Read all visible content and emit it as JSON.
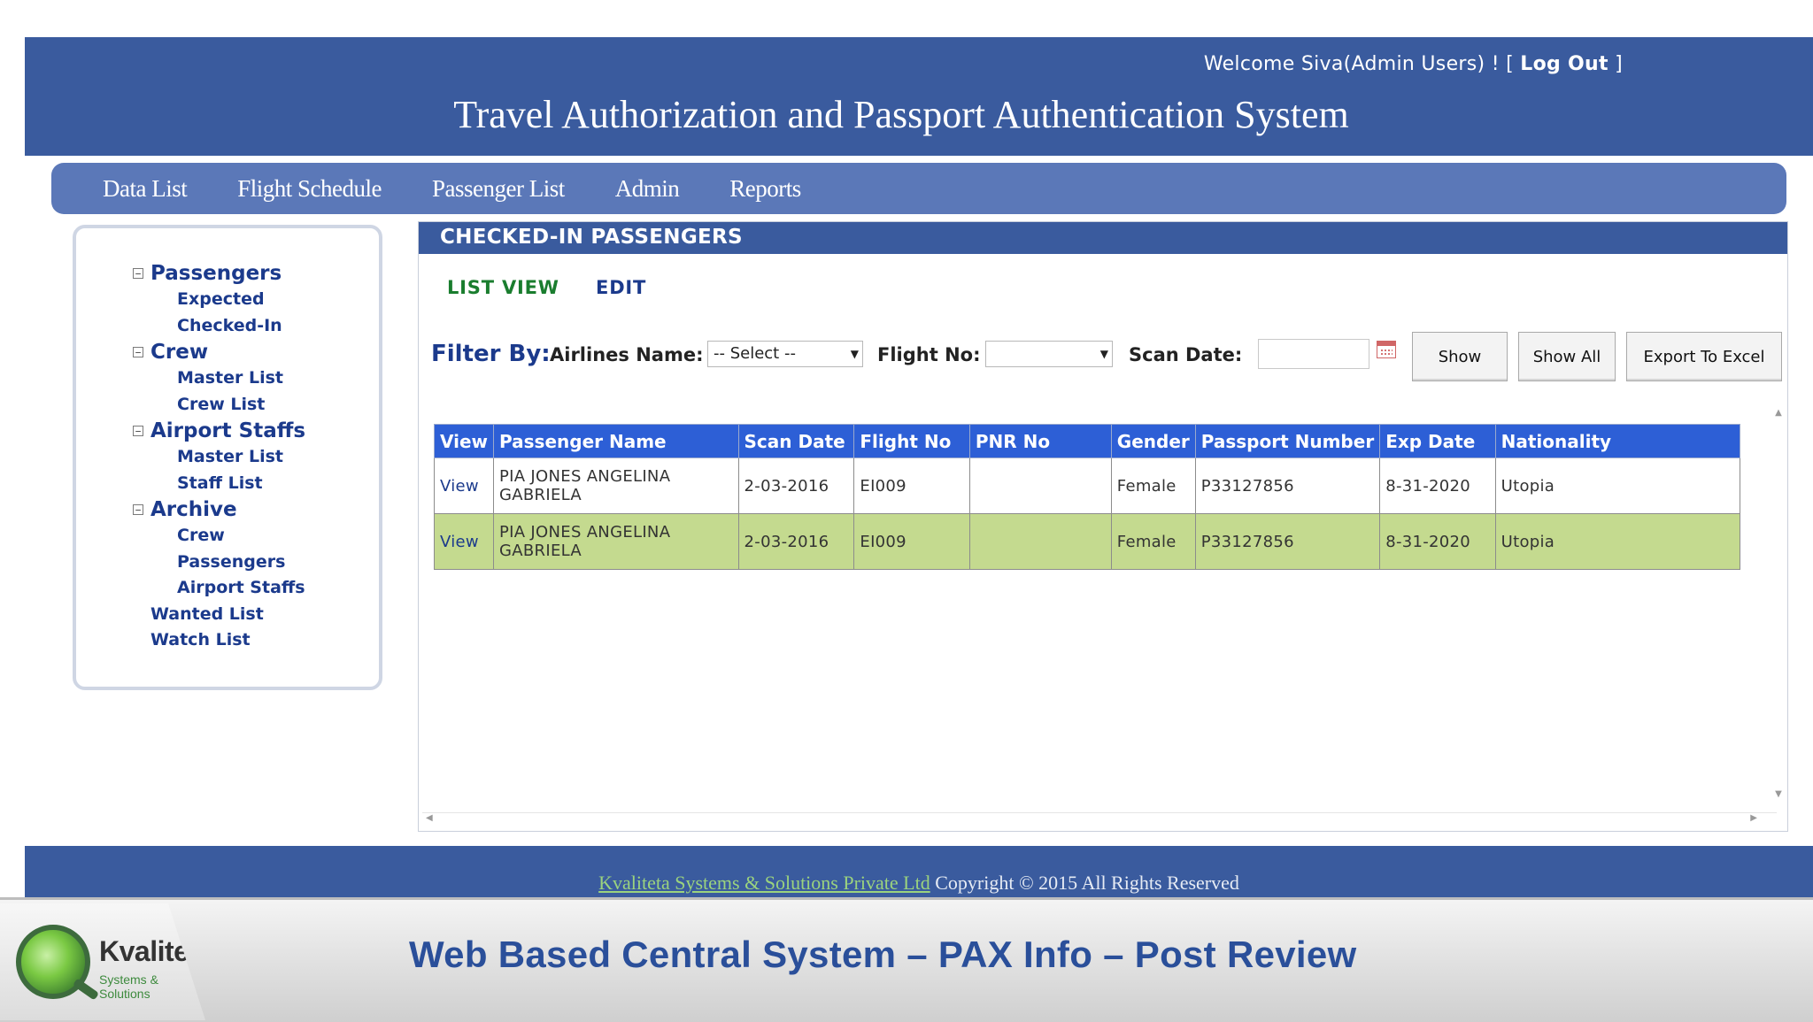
{
  "header": {
    "welcome_prefix": "Welcome Siva(Admin Users) ! [ ",
    "logout_label": "Log Out",
    "welcome_suffix": " ]",
    "app_title": "Travel Authorization and Passport Authentication System"
  },
  "nav": [
    "Data List",
    "Flight Schedule",
    "Passenger List",
    "Admin",
    "Reports"
  ],
  "sidebar": {
    "toggle_icon": "−",
    "groups": [
      {
        "label": "Passengers",
        "children": [
          "Expected",
          "Checked-In"
        ]
      },
      {
        "label": "Crew",
        "children": [
          "Master List",
          "Crew List"
        ]
      },
      {
        "label": "Airport Staffs",
        "children": [
          "Master List",
          "Staff List"
        ]
      },
      {
        "label": "Archive",
        "children": [
          "Crew",
          "Passengers",
          "Airport Staffs"
        ]
      }
    ],
    "leaves": [
      "Wanted List",
      "Watch List"
    ]
  },
  "panel": {
    "title": "CHECKED-IN PASSENGERS",
    "tabs": {
      "list_view": "LIST VIEW",
      "edit": "EDIT"
    },
    "filter": {
      "filter_by": "Filter By:",
      "airlines_label": "Airlines Name:",
      "airlines_value": "-- Select --",
      "flight_label": "Flight No:",
      "flight_value": "",
      "scan_date_label": "Scan Date:",
      "scan_date_value": "",
      "show": "Show",
      "show_all": "Show All",
      "export": "Export To Excel"
    },
    "table": {
      "columns": [
        "View",
        "Passenger Name",
        "Scan Date",
        "Flight No",
        "PNR No",
        "Gender",
        "Passport Number",
        "Exp Date",
        "Nationality"
      ],
      "rows": [
        [
          "View",
          "PIA JONES ANGELINA GABRIELA",
          "2-03-2016",
          "EI009",
          "",
          "Female",
          "P33127856",
          "8-31-2020",
          "Utopia"
        ],
        [
          "View",
          "PIA JONES ANGELINA GABRIELA",
          "2-03-2016",
          "EI009",
          "",
          "Female",
          "P33127856",
          "8-31-2020",
          "Utopia"
        ]
      ]
    }
  },
  "footer": {
    "company": "Kvaliteta Systems & Solutions Private Ltd",
    "copyright": " Copyright © 2015 All Rights Reserved"
  },
  "banner": {
    "logo_name": "Kvaliteta",
    "logo_tagline": "Systems & Solutions",
    "title": "Web Based Central System – PAX Info – Post Review"
  },
  "colors": {
    "header_blue": "#3a5b9e",
    "nav_blue": "#5b78b8",
    "table_header": "#2d5fd6",
    "row_highlight": "#c4da8f",
    "link_green": "#1a7d2e"
  }
}
